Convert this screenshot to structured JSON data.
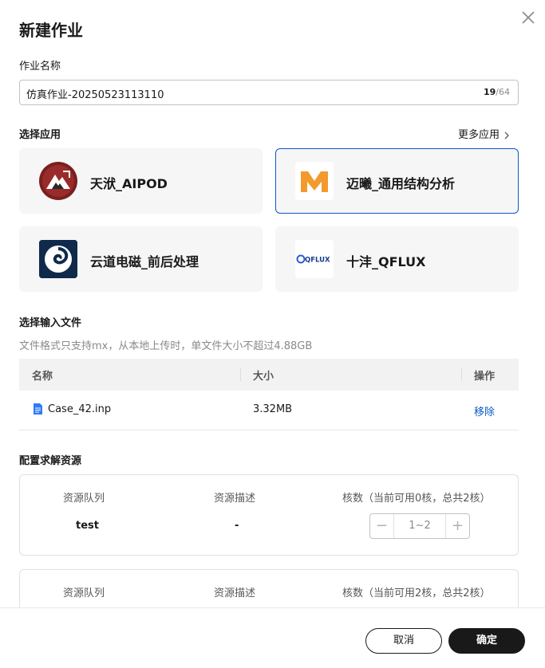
{
  "dialog": {
    "title": "新建作业"
  },
  "job_name": {
    "label": "作业名称",
    "value": "仿真作业-20250523113110",
    "count_current": "19",
    "count_max": "/64"
  },
  "apps": {
    "label": "选择应用",
    "more_label": "更多应用",
    "items": [
      {
        "name": "天洑_AIPOD",
        "selected": false
      },
      {
        "name": "迈曦_通用结构分析",
        "selected": true
      },
      {
        "name": "云道电磁_前后处理",
        "selected": false
      },
      {
        "name": "十沣_QFLUX",
        "selected": false,
        "logo_text": "QFLUX"
      }
    ]
  },
  "input_files": {
    "label": "选择输入文件",
    "hint": "文件格式只支持mx，从本地上传时，单文件大小不超过4.88GB",
    "columns": [
      "名称",
      "大小",
      "操作"
    ],
    "rows": [
      {
        "name": "Case_42.inp",
        "size": "3.32MB",
        "action": "移除"
      }
    ]
  },
  "resources": {
    "label": "配置求解资源",
    "cards": [
      {
        "h_queue": "资源队列",
        "h_desc": "资源描述",
        "h_cores": "核数（当前可用0核，总共2核）",
        "queue": "test",
        "desc": "-",
        "cores_placeholder": "1~2"
      },
      {
        "h_queue": "资源队列",
        "h_desc": "资源描述",
        "h_cores": "核数（当前可用2核，总共2核）"
      }
    ]
  },
  "footer": {
    "cancel": "取消",
    "confirm": "确定"
  },
  "colors": {
    "accent": "#0a59c9",
    "primary_button": "#191919",
    "selected_border": "#0a59c9"
  }
}
